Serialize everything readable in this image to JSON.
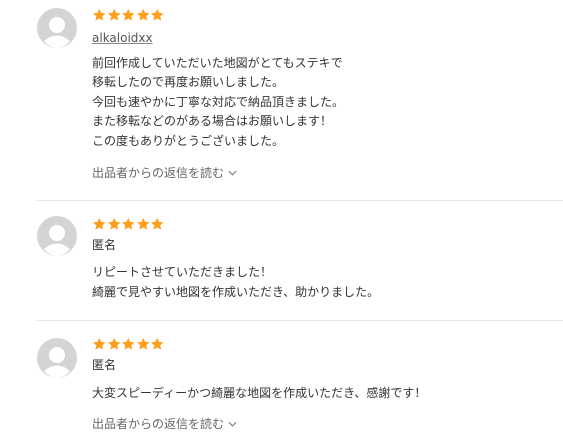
{
  "colors": {
    "star": "#ff9f1c",
    "avatar_bg": "#d4d4d4",
    "avatar_fg": "#ffffff",
    "divider": "#e6e6e6"
  },
  "reviews": [
    {
      "rating": 5,
      "reviewer": "alkaloidxx",
      "comment": [
        "前回作成していただいた地図がとてもステキで",
        "移転したので再度お願いしました。",
        "今回も速やかに丁寧な対応で納品頂きました。",
        "また移転などのがある場合はお願いします！",
        "この度もありがとうございました。"
      ],
      "reply_link": "出品者からの返信を読む"
    },
    {
      "rating": 5,
      "reviewer": "匿名",
      "comment": [
        "リピートさせていただきました！",
        "綺麗で見やすい地図を作成いただき、助かりました。"
      ]
    },
    {
      "rating": 5,
      "reviewer": "匿名",
      "comment": [
        "大変スピーディーかつ綺麗な地図を作成いただき、感謝です！"
      ],
      "reply_link": "出品者からの返信を読む"
    }
  ]
}
